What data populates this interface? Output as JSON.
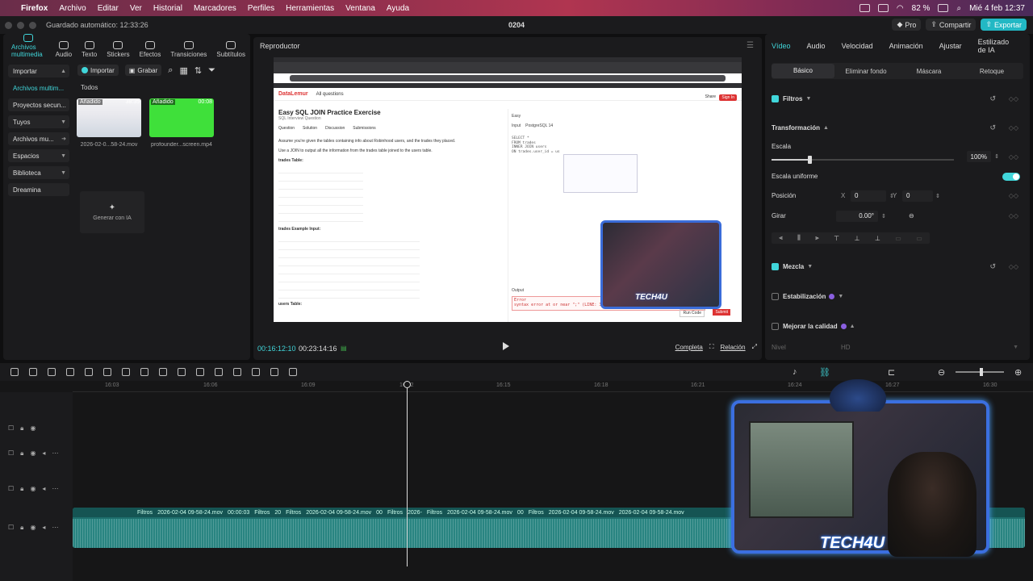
{
  "menubar": {
    "app": "Firefox",
    "items": [
      "Archivo",
      "Editar",
      "Ver",
      "Historial",
      "Marcadores",
      "Perfiles",
      "Herramientas",
      "Ventana",
      "Ayuda"
    ],
    "battery": "82 %",
    "datetime": "Mié 4 feb 12:37"
  },
  "titlebar": {
    "autosave": "Guardado automático: 12:33:26",
    "project": "0204",
    "pro": "Pro",
    "share": "Compartir",
    "export": "Exportar"
  },
  "media": {
    "tabs": [
      "Archivos multimedia",
      "Audio",
      "Texto",
      "Stickers",
      "Efectos",
      "Transiciones",
      "Subtítulos"
    ],
    "side": [
      "Importar",
      "Archivos multim...",
      "Proyectos secun...",
      "Tuyos",
      "Archivos mu...",
      "Espacios",
      "Biblioteca",
      "Dreamina"
    ],
    "import": "Importar",
    "record": "Grabar",
    "all": "Todos",
    "thumb1_tag": "Añadido",
    "thumb1_dur": "38:35",
    "thumb1_name": "2026-02-0...58-24.mov",
    "thumb2_tag": "Añadido",
    "thumb2_dur": "00:08",
    "thumb2_name": "profounder...screen.mp4",
    "gen_ai": "Generar con IA"
  },
  "player": {
    "title": "Reproductor",
    "current": "00:16:12:10",
    "total": "00:23:14:16",
    "full": "Completa",
    "ratio": "Relación",
    "screen": {
      "site": "DataLemur",
      "all_questions": "All questions",
      "share": "Share",
      "signin": "Sign In",
      "title": "Easy SQL JOIN Practice Exercise",
      "subtitle": "SQL Interview Question",
      "tabs": [
        "Question",
        "Solution",
        "Discussion",
        "Submissions"
      ],
      "desc1": "Assume you're given the tables containing info about Robinhood users, and the trades they placed.",
      "desc2": "Use a JOIN to output all the information from the trades table joined to the users table.",
      "trades_table": "trades Table:",
      "trades_input": "trades Example Input:",
      "users_table": "users Table:",
      "difficulty": "Easy",
      "input": "Input",
      "engine": "PostgreSQL 14",
      "code": [
        "SELECT *",
        "FROM trades",
        "INNER JOIN users",
        "ON trades.user_id = us"
      ],
      "output": "Output",
      "error_title": "Error",
      "error": "syntax error at or near \";\" (LINE: 3)",
      "run": "Run Code",
      "submit": "Submit",
      "brand": "TECH4U"
    }
  },
  "inspector": {
    "tabs": [
      "Vídeo",
      "Audio",
      "Velocidad",
      "Animación",
      "Ajustar",
      "Estilizado de IA"
    ],
    "subtabs": [
      "Básico",
      "Eliminar fondo",
      "Máscara",
      "Retoque"
    ],
    "filters": "Filtros",
    "transform": "Transformación",
    "scale": "Escala",
    "scale_value": "100%",
    "scale_level": 0.21,
    "uniform": "Escala uniforme",
    "position": "Posición",
    "x_label": "X",
    "x_value": "0",
    "y_label": "Y",
    "y_value": "0",
    "rotate": "Girar",
    "rotate_value": "0.00°",
    "blend": "Mezcla",
    "stabilize": "Estabilización",
    "quality": "Mejorar la calidad",
    "level": "Nivel",
    "level_value": "HD"
  },
  "timeline": {
    "ticks": [
      "16:03",
      "16:06",
      "16:09",
      "16:12",
      "16:15",
      "16:18",
      "16:21",
      "16:24",
      "16:27",
      "16:30"
    ],
    "clips": [
      "Filtros",
      "2026-02-04 09-58-24.mov",
      "00:00:03",
      "Filtros",
      "20",
      "Filtros",
      "2026-02-04 09-58-24.mov",
      "00",
      "Filtros",
      "2026-",
      "Filtros",
      "2026-02-04 09-58-24.mov",
      "00",
      "Filtros",
      "2026-02-04 09-58-24.mov",
      "2026-02-04 09-58-24.mov"
    ],
    "brand": "TECH4U"
  }
}
